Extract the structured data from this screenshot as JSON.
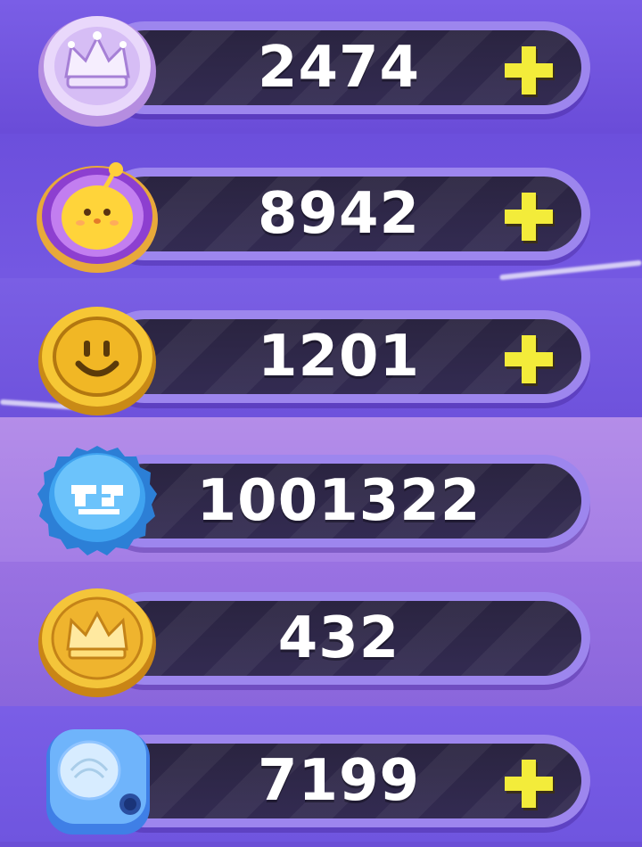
{
  "currencies": [
    {
      "amount": "2474",
      "icon": "purple-crown-coin-icon",
      "has_plus": true
    },
    {
      "amount": "8942",
      "icon": "yellow-chick-coin-icon",
      "has_plus": true
    },
    {
      "amount": "1201",
      "icon": "smiley-gold-coin-icon",
      "has_plus": true
    },
    {
      "amount": "1001322",
      "icon": "blue-bottle-cap-icon",
      "has_plus": false
    },
    {
      "amount": "432",
      "icon": "gold-crown-coin-icon",
      "has_plus": false
    },
    {
      "amount": "7199",
      "icon": "blue-gem-die-icon",
      "has_plus": true
    }
  ],
  "colors": {
    "plus": "#f3ec3a",
    "bar_border": "#9d86ee",
    "bar_fill": "#2a2440",
    "text": "#ffffff"
  }
}
